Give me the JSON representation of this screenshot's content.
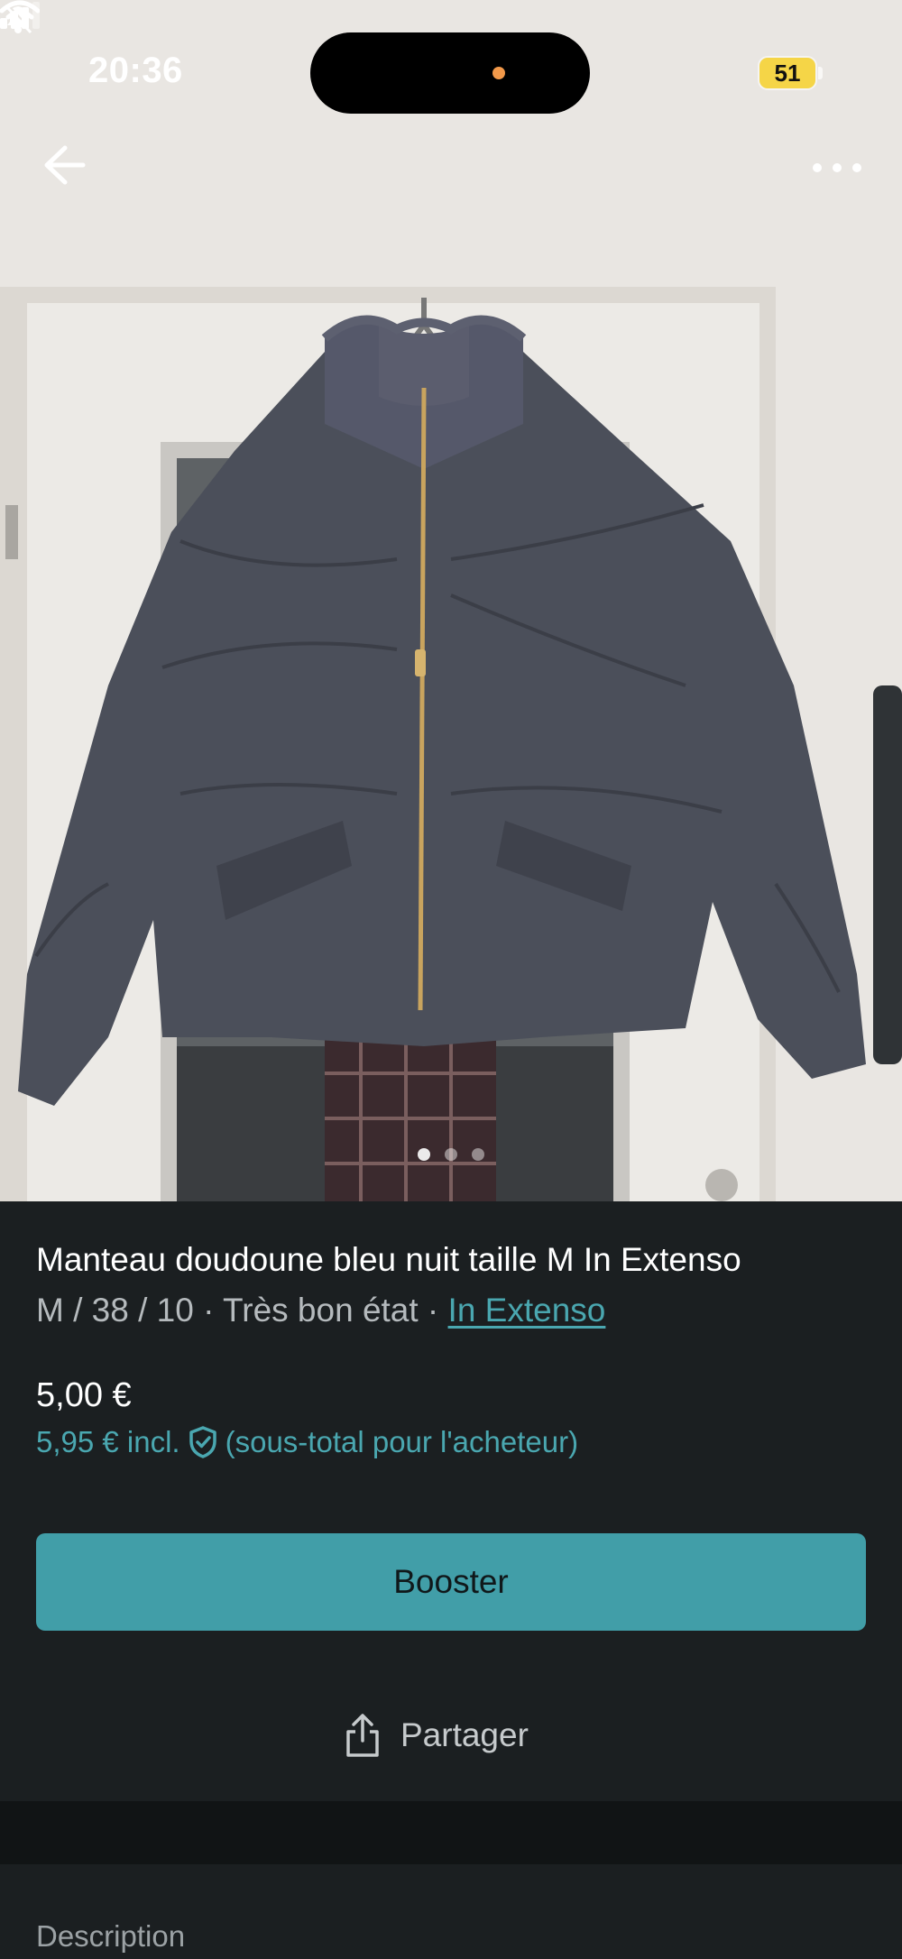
{
  "status_bar": {
    "time": "20:36",
    "battery": "51"
  },
  "nav": {
    "back_icon": "arrow-left-icon",
    "more_icon": "ellipsis-icon"
  },
  "listing": {
    "title": "Manteau doudoune bleu nuit taille M In Extenso",
    "subtitle_prefix": "M / 38 / 10 · Très bon état · ",
    "brand": "In Extenso",
    "price": "5,00 €",
    "buyer_price": "5,95 € incl.",
    "buyer_note": "(sous-total pour l'acheteur)"
  },
  "actions": {
    "booster_label": "Booster",
    "share_label": "Partager"
  },
  "sections": {
    "description_heading": "Description"
  },
  "colors": {
    "accent": "#419ea8",
    "link": "#4aa7b0",
    "background": "#1b1f21",
    "battery": "#f5d547"
  }
}
